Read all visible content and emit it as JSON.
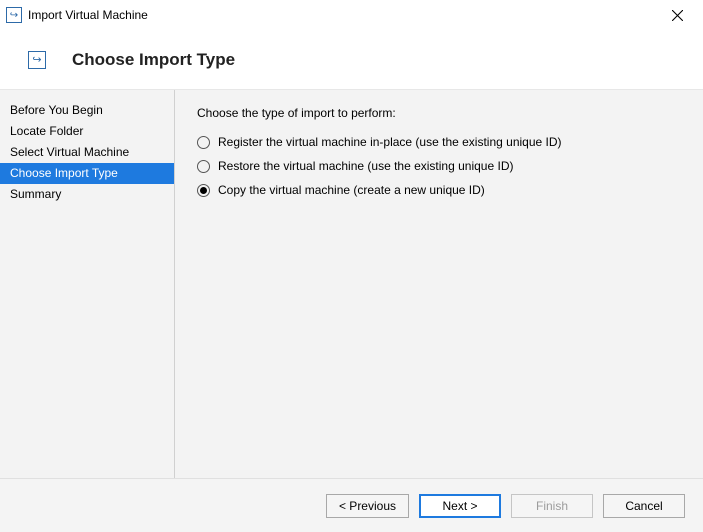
{
  "window": {
    "title": "Import Virtual Machine"
  },
  "header": {
    "heading": "Choose Import Type"
  },
  "sidebar": {
    "items": [
      {
        "label": "Before You Begin"
      },
      {
        "label": "Locate Folder"
      },
      {
        "label": "Select Virtual Machine"
      },
      {
        "label": "Choose Import Type"
      },
      {
        "label": "Summary"
      }
    ],
    "selected_index": 3
  },
  "content": {
    "instruction": "Choose the type of import to perform:",
    "options": [
      {
        "label": "Register the virtual machine in-place (use the existing unique ID)"
      },
      {
        "label": "Restore the virtual machine (use the existing unique ID)"
      },
      {
        "label": "Copy the virtual machine (create a new unique ID)"
      }
    ],
    "selected_index": 2
  },
  "footer": {
    "previous": "< Previous",
    "next": "Next >",
    "finish": "Finish",
    "cancel": "Cancel"
  }
}
